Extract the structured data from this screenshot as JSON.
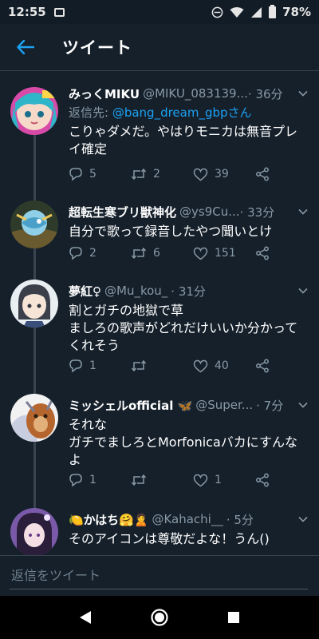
{
  "status_bar": {
    "time": "12:55",
    "battery": "78%"
  },
  "header": {
    "title": "ツイート"
  },
  "tweets": [
    {
      "name": "みっくMIKU",
      "handle": "@MIKU_083139...",
      "time": "· 36分",
      "reply_prefix": "返信先: ",
      "reply_mention": "@bang_dream_gbpさん",
      "text": "こりゃダメだ。やはりモニカは無音プレイ確定",
      "replies": "5",
      "retweets": "2",
      "likes": "39"
    },
    {
      "name": "超転生寒ブリ獣神化",
      "handle": "@ys9Cu...",
      "time": "· 33分",
      "text": "自分で歌って録音したやつ聞いとけ",
      "replies": "2",
      "retweets": "6",
      "likes": "151"
    },
    {
      "name": "夢紅♀",
      "handle": "@Mu_kou_",
      "time": "· 31分",
      "text": "割とガチの地獄で草\nましろの歌声がどれだけいいか分かってくれそう",
      "replies": "1",
      "retweets": "",
      "likes": "40"
    },
    {
      "name": "ミッシェルofficial 🦋",
      "handle": "@Super...",
      "time": "· 7分",
      "text": "それな\nガチでましろとMorfonicaバカにすんなよ",
      "replies": "1",
      "retweets": "",
      "likes": "1"
    },
    {
      "name": "🍋かはち🤗🙎",
      "handle": "@Kahachi__",
      "time": "· 5分",
      "text": "そのアイコンは尊敬だよな！うん()"
    }
  ],
  "reply_bar": {
    "placeholder": "返信をツイート"
  },
  "colors": {
    "background": "#15202b",
    "accent": "#1da1f2",
    "secondary_text": "#8899a6",
    "divider": "#38444d"
  }
}
